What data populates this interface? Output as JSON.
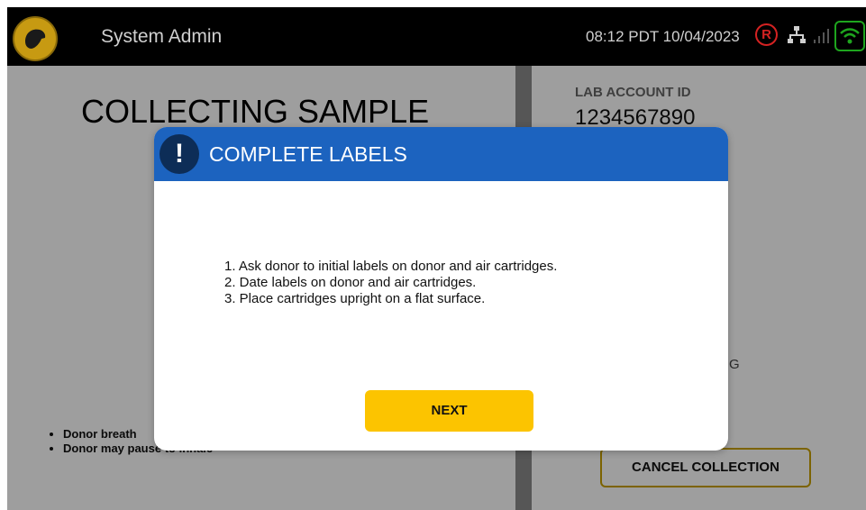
{
  "topbar": {
    "title": "System Admin",
    "datetime": "08:12 PDT 10/04/2023",
    "r_badge": "R",
    "icons": [
      "dog-logo-icon",
      "registered-icon",
      "network-icon",
      "signal-icon",
      "wifi-icon"
    ],
    "colors": {
      "logo": "#c79a12",
      "registered": "#d42222",
      "wifi": "#1ea51e"
    }
  },
  "left_panel": {
    "title": "COLLECTING SAMPLE",
    "bullets": [
      "Donor breath",
      "Donor may pause to inhale"
    ]
  },
  "right_panel": {
    "lab_account_label": "LAB ACCOUNT ID",
    "lab_account_value": "1234567890",
    "partial_text": "G",
    "cancel_label": "CANCEL COLLECTION"
  },
  "modal": {
    "icon_glyph": "!",
    "title": "COMPLETE LABELS",
    "instructions": [
      "1. Ask donor to initial labels on donor and air cartridges.",
      "2. Date labels on donor and air cartridges.",
      "3. Place cartridges upright on a flat surface."
    ],
    "next_label": "NEXT",
    "colors": {
      "header": "#1c63bf",
      "button": "#fcc400"
    }
  }
}
